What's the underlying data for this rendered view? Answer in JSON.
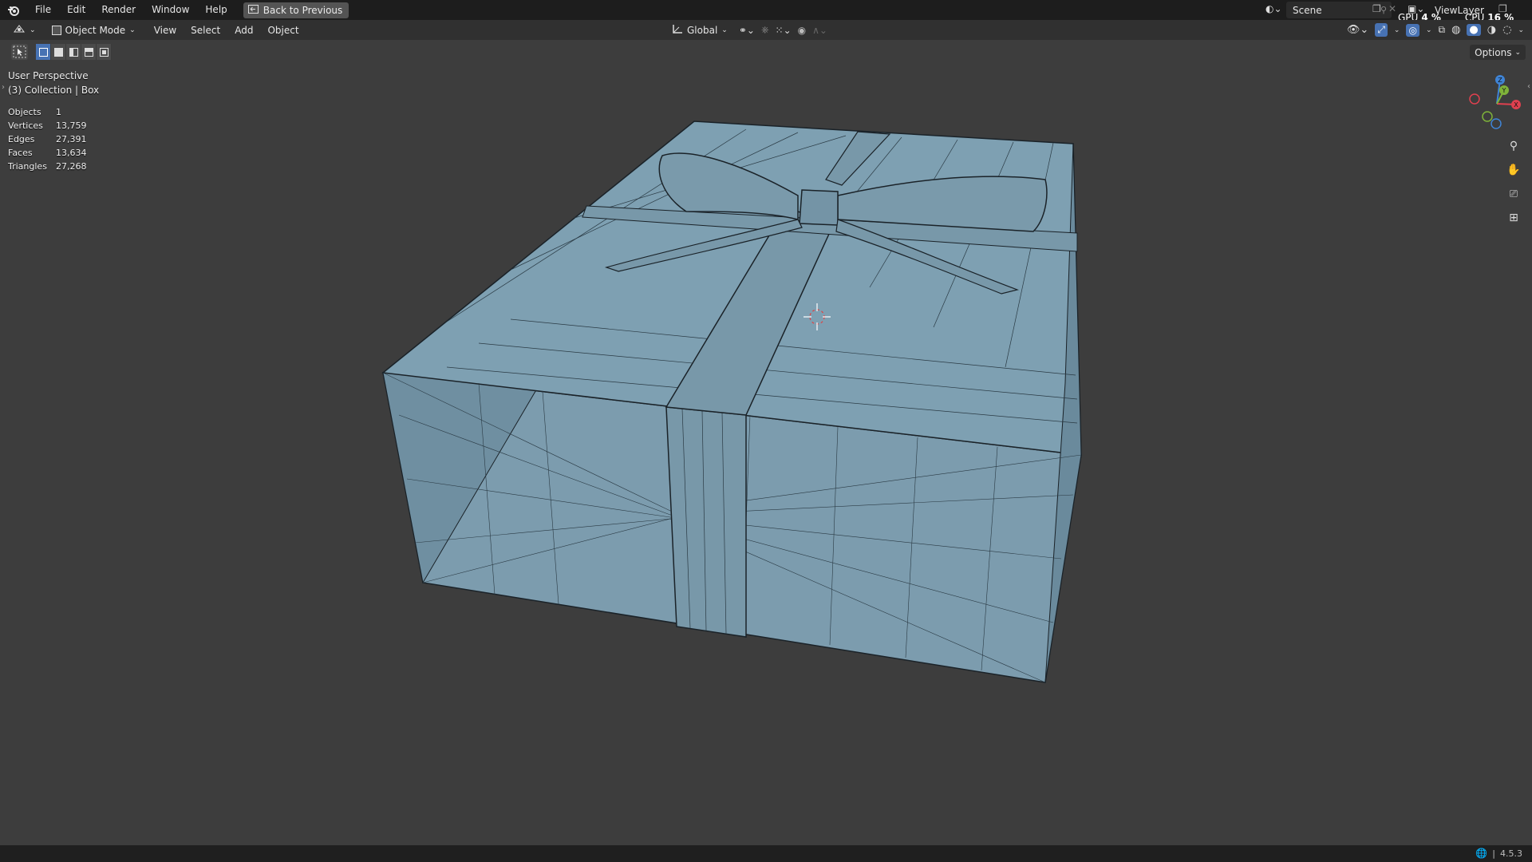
{
  "topbar": {
    "menus": [
      "File",
      "Edit",
      "Render",
      "Window",
      "Help"
    ],
    "back_label": "Back to Previous",
    "scene_label": "Scene",
    "viewlayer_label": "ViewLayer",
    "gpu_label": "GPU",
    "gpu_value": "4 %",
    "cpu_label": "CPU",
    "cpu_value": "16 %"
  },
  "header": {
    "mode_label": "Object Mode",
    "menus": [
      "View",
      "Select",
      "Add",
      "Object"
    ],
    "transform_orientation": "Global"
  },
  "toolbar": {
    "options_label": "Options"
  },
  "viewport": {
    "view_name": "User Perspective",
    "collection": "(3) Collection | Box",
    "stats": [
      {
        "label": "Objects",
        "value": "1"
      },
      {
        "label": "Vertices",
        "value": "13,759"
      },
      {
        "label": "Edges",
        "value": "27,391"
      },
      {
        "label": "Faces",
        "value": "13,634"
      },
      {
        "label": "Triangles",
        "value": "27,268"
      }
    ],
    "gizmo_axes": {
      "x": "X",
      "y": "Y",
      "z": "Z"
    }
  },
  "statusbar": {
    "version": "4.5.3"
  },
  "colors": {
    "accent": "#4772b3",
    "mesh": "#7fa0b3",
    "wire": "#1a2228",
    "background": "#3d3d3d",
    "axis_x": "#e0404f",
    "axis_y": "#7fb33a",
    "axis_z": "#3f84d6"
  }
}
